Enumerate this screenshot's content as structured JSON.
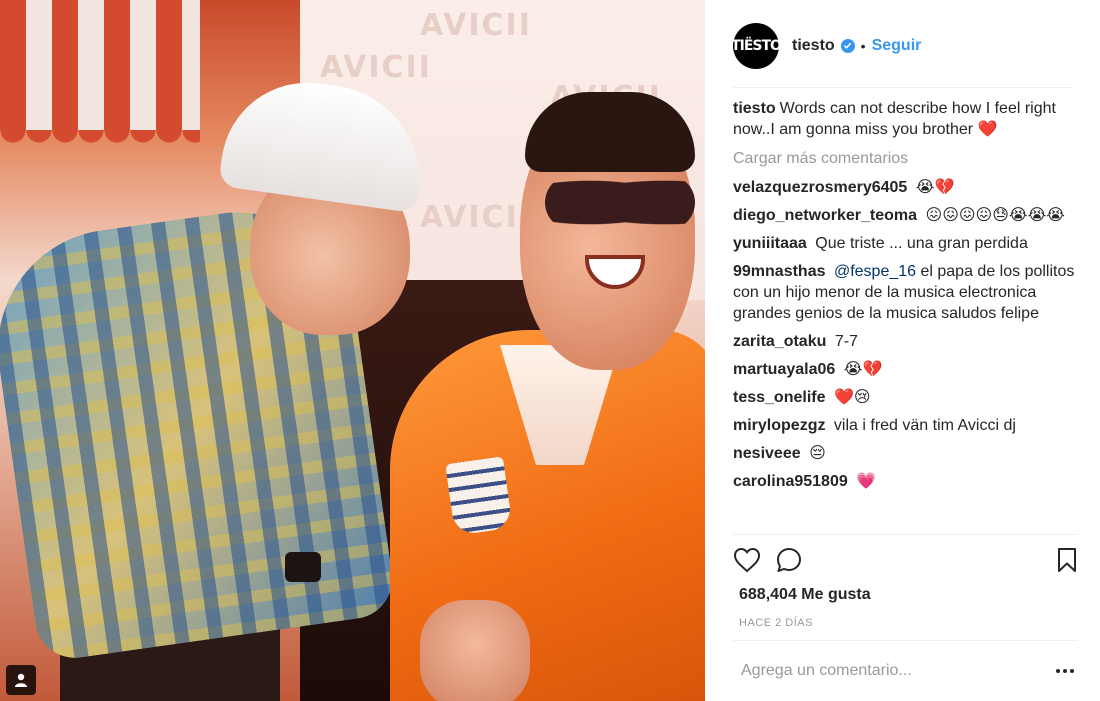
{
  "photo": {
    "background_logo_text": "AVICII",
    "tag_icon": "user-tag-icon"
  },
  "header": {
    "avatar_text": "TIËSTO",
    "username": "tiesto",
    "verified_icon": "verified-badge-icon",
    "separator": "•",
    "follow_label": "Seguir"
  },
  "caption": {
    "user": "tiesto",
    "text": "Words can not describe how I feel right now..I am gonna miss you brother ❤️"
  },
  "load_more_label": "Cargar más comentarios",
  "comments": [
    {
      "user": "velazquezrosmery6405",
      "text": "😭💔"
    },
    {
      "user": "diego_networker_teoma",
      "text": "😖😖😖😖😓😭😭😭"
    },
    {
      "user": "yuniiitaaa",
      "text": "Que triste ... una gran perdida"
    },
    {
      "user": "99mnasthas",
      "mention": "@fespe_16",
      "text": "el papa de los pollitos con un hijo menor de la musica electronica grandes genios de la musica saludos felipe"
    },
    {
      "user": "zarita_otaku",
      "text": "7-7"
    },
    {
      "user": "martuayala06",
      "text": "😭💔"
    },
    {
      "user": "tess_onelife",
      "text": "❤️😢"
    },
    {
      "user": "mirylopezgz",
      "text": "vila i fred vän tim Avicci dj"
    },
    {
      "user": "nesiveee",
      "text": "😔"
    },
    {
      "user": "carolina951809",
      "text": "💗"
    }
  ],
  "actions": {
    "like_icon": "heart-icon",
    "comment_icon": "comment-bubble-icon",
    "save_icon": "bookmark-icon"
  },
  "likes": "688,404 Me gusta",
  "timestamp": "HACE 2 DÍAS",
  "add_comment": {
    "placeholder": "Agrega un comentario...",
    "more_icon": "more-options-icon"
  },
  "colors": {
    "link_blue": "#3897f0",
    "text": "#262626",
    "muted": "#999999",
    "divider": "#efefef"
  }
}
